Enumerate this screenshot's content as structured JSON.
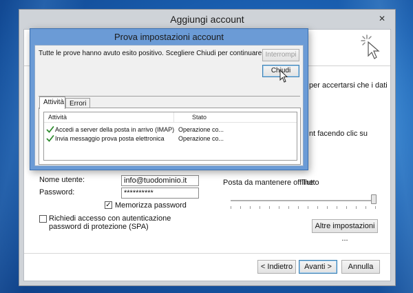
{
  "main_window": {
    "title": "Aggiungi account",
    "close_glyph": "✕",
    "partial_right_1": "per accertarsi che i dati",
    "partial_right_2": "nt facendo clic su",
    "username_label": "Nome utente:",
    "username_value": "info@tuodominio.it",
    "password_label": "Password:",
    "password_value": "**********",
    "remember_label": "Memorizza password",
    "spa_label": "Richiedi accesso con autenticazione password di protezione (SPA)",
    "offline_label": "Posta da mantenere offline:",
    "offline_value": "Tutto",
    "more_settings": "Altre impostazioni ...",
    "back_button": "< Indietro",
    "next_button": "Avanti >",
    "cancel_button": "Annulla"
  },
  "dialog": {
    "title": "Prova impostazioni account",
    "message": "Tutte le prove hanno avuto esito positivo. Scegliere Chiudi per continuare.",
    "stop_button": "Interrompi",
    "close_button": "Chiudi",
    "tabs": [
      {
        "label": "Attività"
      },
      {
        "label": "Errori"
      }
    ],
    "columns": {
      "task": "Attività",
      "status": "Stato"
    },
    "rows": [
      {
        "task": "Accedi a server della posta in arrivo (IMAP)",
        "status": "Operazione co..."
      },
      {
        "task": "Invia messaggio prova posta elettronica",
        "status": "Operazione co..."
      }
    ]
  },
  "icons": {
    "header": "click-cursor-icon",
    "pointer": "mouse-pointer-icon",
    "row_status": "checkmark-icon"
  },
  "colors": {
    "dialog_frame": "#6b9bd6",
    "check_green": "#2e8b2e",
    "desktop": "#1a5fb0"
  }
}
